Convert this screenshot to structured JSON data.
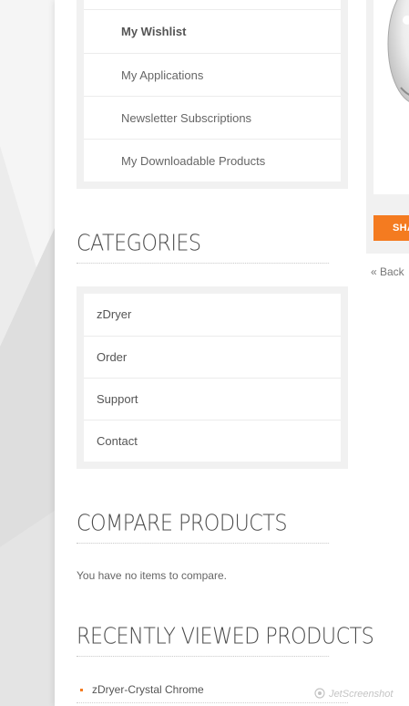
{
  "account_nav": {
    "items": [
      {
        "label": "My Wishlist",
        "active": true
      },
      {
        "label": "My Applications",
        "active": false
      },
      {
        "label": "Newsletter Subscriptions",
        "active": false
      },
      {
        "label": "My Downloadable Products",
        "active": false
      }
    ]
  },
  "categories": {
    "title": "CATEGORIES",
    "items": [
      "zDryer",
      "Order",
      "Support",
      "Contact"
    ]
  },
  "compare": {
    "title": "COMPARE PRODUCTS",
    "empty_text": "You have no items to compare."
  },
  "recently_viewed": {
    "title": "RECENTLY VIEWED PRODUCTS",
    "items": [
      "zDryer-Crystal Chrome"
    ]
  },
  "product": {
    "share_label": "SHA",
    "back_label": "« Back"
  },
  "watermark": {
    "text": "JetScreenshot",
    "icon": "camera-lens-icon"
  },
  "colors": {
    "accent": "#f47b20",
    "panel": "#f1f1f1",
    "background": "#e9e9e9"
  }
}
